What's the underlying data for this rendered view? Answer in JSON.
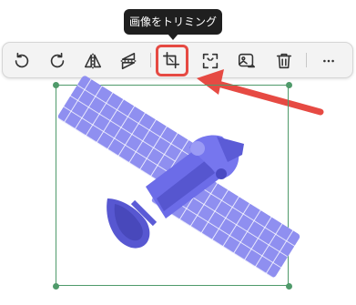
{
  "tooltip": {
    "text": "画像をトリミング"
  },
  "toolbar": {
    "tools": [
      {
        "name": "rotate-left"
      },
      {
        "name": "rotate-right"
      },
      {
        "name": "flip-horizontal"
      },
      {
        "name": "flip-vertical"
      },
      {
        "name": "crop",
        "active": true
      },
      {
        "name": "fit-frame"
      },
      {
        "name": "replace-image"
      },
      {
        "name": "delete"
      },
      {
        "name": "more"
      }
    ]
  },
  "colors": {
    "highlight": "#e64a43",
    "selection": "#4f9a6a",
    "satellite_dark": "#5b5bd6",
    "satellite_light": "#8f8ff0"
  }
}
